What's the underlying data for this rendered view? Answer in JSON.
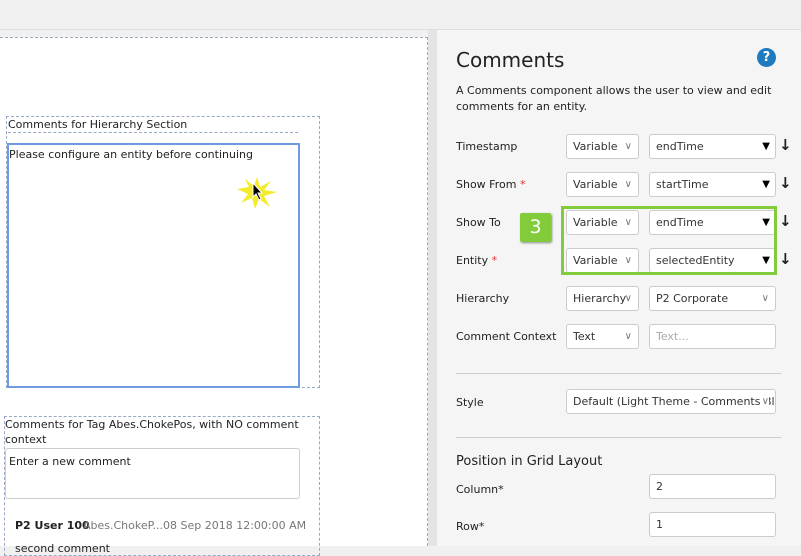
{
  "canvas": {
    "section1": {
      "title": "Comments for Hierarchy Section",
      "message": "Please configure an entity before continuing"
    },
    "section2": {
      "title": "Comments for Tag Abes.ChokePos, with NO comment context",
      "input_placeholder": "Enter a new comment",
      "comment": {
        "user": "P2 User 100",
        "tag": "Abes.ChokeP...",
        "date": "08 Sep 2018 12:00:00 AM",
        "text": "second comment"
      }
    }
  },
  "panel": {
    "title": "Comments",
    "help": "?",
    "description": "A Comments component allows the user to view and edit comments for an entity.",
    "fields": [
      {
        "label": "Timestamp",
        "required": false,
        "type": "Variable",
        "value": "endTime"
      },
      {
        "label": "Show From",
        "required": true,
        "type": "Variable",
        "value": "startTime"
      },
      {
        "label": "Show To",
        "required": false,
        "type": "Variable",
        "value": "endTime"
      },
      {
        "label": "Entity",
        "required": true,
        "type": "Variable",
        "value": "selectedEntity"
      },
      {
        "label": "Hierarchy",
        "required": false,
        "type": "Hierarchy",
        "value": "P2 Corporate"
      },
      {
        "label": "Comment Context",
        "required": false,
        "type": "Text",
        "placeholder": "Text..."
      }
    ],
    "style": {
      "label": "Style",
      "value": "Default (Light Theme - Comments Blo"
    },
    "grid": {
      "heading": "Position in Grid Layout",
      "column_label": "Column*",
      "column": "2",
      "row_label": "Row*",
      "row": "1"
    },
    "step_badge": "3",
    "required_mark": "*",
    "accent": "#82cc3b"
  }
}
